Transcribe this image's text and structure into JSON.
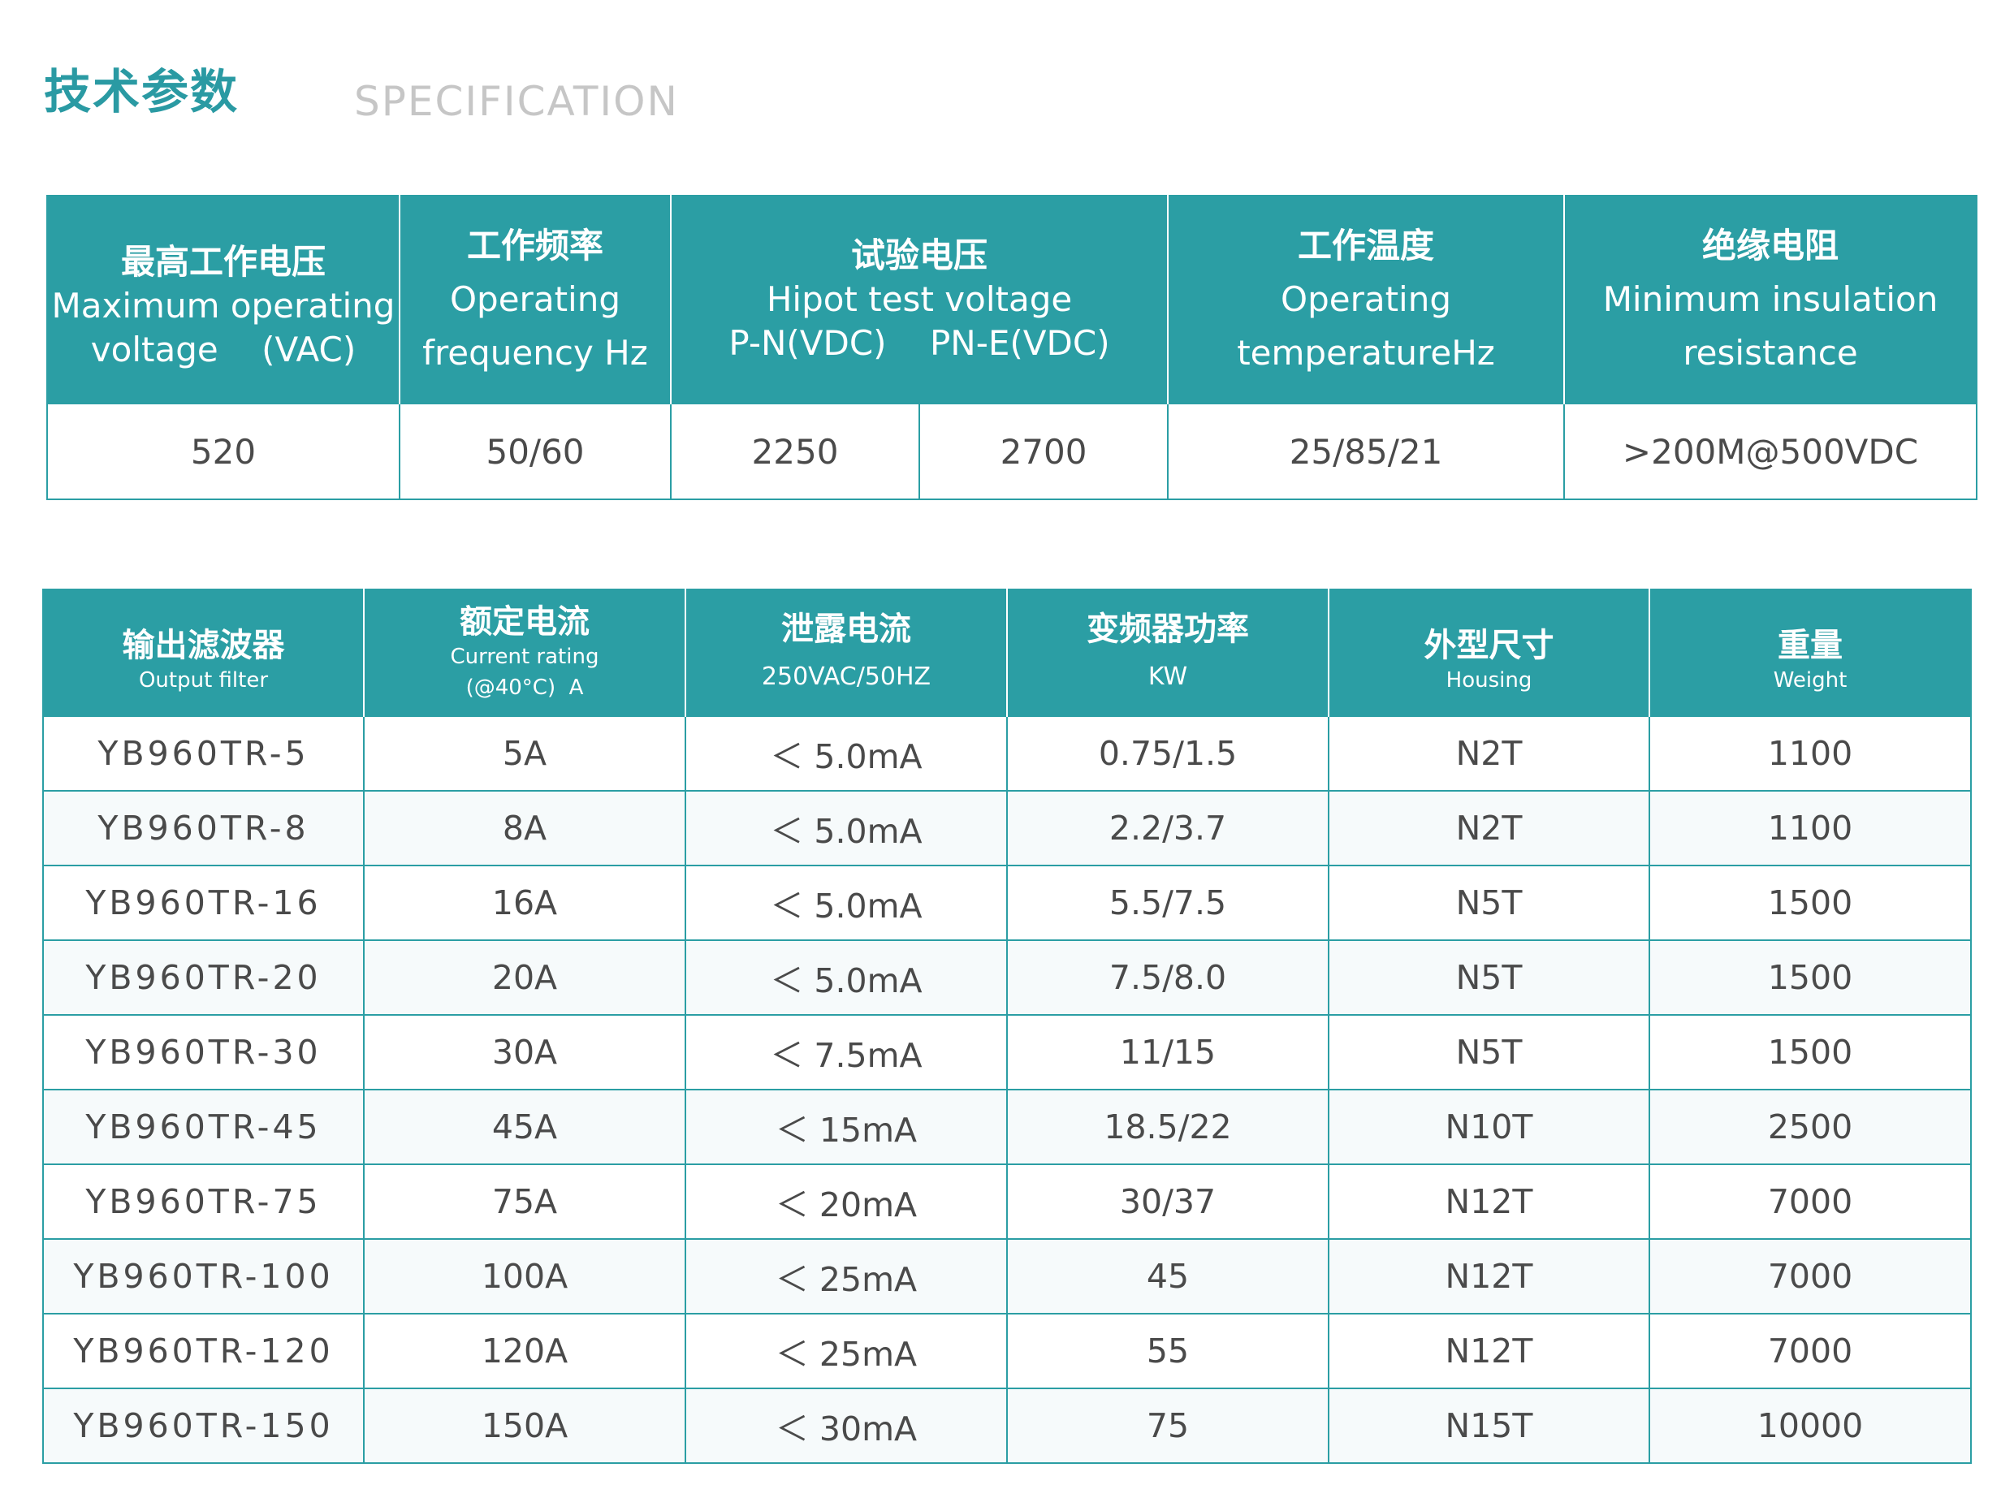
{
  "header": {
    "title_cn": "技术参数",
    "title_en": "SPECIFICATION"
  },
  "spec_table": {
    "headers": [
      {
        "cn": "最高工作电压",
        "en1": "Maximum operating",
        "en2": "voltage    (VAC)"
      },
      {
        "cn": "工作频率",
        "en1": "Operating",
        "en2": "frequency Hz"
      },
      {
        "cn": "试验电压",
        "en1": "Hipot test voltage",
        "en2": "P-N(VDC)    PN-E(VDC)"
      },
      {
        "cn": "工作温度",
        "en1": "Operating",
        "en2": "temperatureHz"
      },
      {
        "cn": "绝缘电阻",
        "en1": "Minimum insulation",
        "en2": "resistance"
      }
    ],
    "values": [
      "520",
      "50/60",
      "2250",
      "2700",
      "25/85/21",
      ">200M@500VDC"
    ]
  },
  "model_table": {
    "headers": [
      {
        "cn": "输出滤波器",
        "en": "Output filter"
      },
      {
        "cn": "额定电流",
        "en": "Current rating",
        "en_sub": "(@40°C)  A"
      },
      {
        "cn": "泄露电流",
        "en": "250VAC/50HZ"
      },
      {
        "cn": "变频器功率",
        "en": "KW"
      },
      {
        "cn": "外型尺寸",
        "en": "Housing"
      },
      {
        "cn": "重量",
        "en": "Weight"
      }
    ],
    "rows": [
      [
        "YB960TR-5",
        "5A",
        "＜ 5.0mA",
        "0.75/1.5",
        "N2T",
        "1100"
      ],
      [
        "YB960TR-8",
        "8A",
        "＜ 5.0mA",
        "2.2/3.7",
        "N2T",
        "1100"
      ],
      [
        "YB960TR-16",
        "16A",
        "＜ 5.0mA",
        "5.5/7.5",
        "N5T",
        "1500"
      ],
      [
        "YB960TR-20",
        "20A",
        "＜ 5.0mA",
        "7.5/8.0",
        "N5T",
        "1500"
      ],
      [
        "YB960TR-30",
        "30A",
        "＜ 7.5mA",
        "11/15",
        "N5T",
        "1500"
      ],
      [
        "YB960TR-45",
        "45A",
        "＜ 15mA",
        "18.5/22",
        "N10T",
        "2500"
      ],
      [
        "YB960TR-75",
        "75A",
        "＜ 20mA",
        "30/37",
        "N12T",
        "7000"
      ],
      [
        "YB960TR-100",
        "100A",
        "＜ 25mA",
        "45",
        "N12T",
        "7000"
      ],
      [
        "YB960TR-120",
        "120A",
        "＜ 25mA",
        "55",
        "N12T",
        "7000"
      ],
      [
        "YB960TR-150",
        "150A",
        "＜ 30mA",
        "75",
        "N15T",
        "10000"
      ]
    ]
  },
  "colors": {
    "accent": "#2b9ea4",
    "title": "#2a9aa3",
    "subtitle": "#c6c6c6",
    "text": "#4a4a4a"
  }
}
